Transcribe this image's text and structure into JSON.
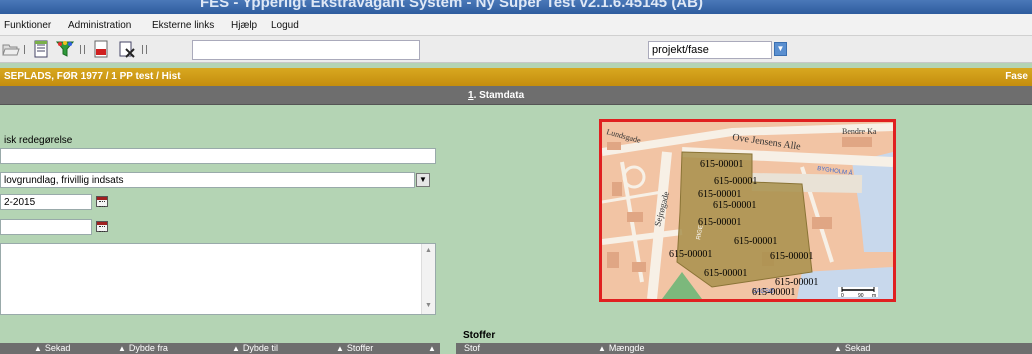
{
  "window": {
    "title": "FES - Ypperligt Ekstravagant System - Ny Super Test v2.1.6.45145 (AB)"
  },
  "menu": {
    "items": [
      "Funktioner",
      "Administration",
      "Eksterne links",
      "Hjælp",
      "Logud"
    ]
  },
  "toolbar": {
    "search_value": "",
    "select_value": "projekt/fase",
    "icons": [
      "open-folder-icon",
      "document-icon",
      "filter-icon",
      "pdf-icon",
      "delete-icon"
    ]
  },
  "path": {
    "text": "SEPLADS, FØR 1977 / 1 PP test / Hist",
    "right_label": "Fase"
  },
  "tab": {
    "number": "1",
    "label": ". Stamdata"
  },
  "form": {
    "section_label": "isk redegørelse",
    "field1_value": "",
    "dropdown_value": "lovgrundlag, frivillig indsats",
    "date1_value": "2-2015",
    "date2_value": "",
    "notes_value": ""
  },
  "map": {
    "streets": [
      "Ove Jensens Alle",
      "Sejrøgade",
      "BYGHOLM Å",
      "DAGSØ",
      "Lundsgade",
      "Bendre Ka",
      "RIGE"
    ],
    "parcel_labels": [
      "615-00001",
      "615-00001",
      "615-00001",
      "615-00001",
      "615-00001",
      "615-00001",
      "615-00001",
      "615-00001",
      "615-00001",
      "615-00001",
      "615-00001"
    ],
    "scale_labels": [
      "0",
      "90",
      "m"
    ],
    "colors": {
      "road": "#f7f0e6",
      "land": "#f2c4a4",
      "parcel": "#a8904c",
      "water": "#c8d8ec",
      "frame": "#e02020"
    }
  },
  "stoffer": {
    "title": "Stoffer",
    "left_columns": [
      "Sekad",
      "Dybde fra",
      "Dybde til",
      "Stoffer"
    ],
    "right_columns": [
      "Stof",
      "Mængde",
      "Sekad"
    ]
  },
  "colors": {
    "accent": "#c48d0e",
    "background": "#b4d4b4",
    "tabbar": "#6e6e6e",
    "titlebar": "#2e5c9e"
  }
}
